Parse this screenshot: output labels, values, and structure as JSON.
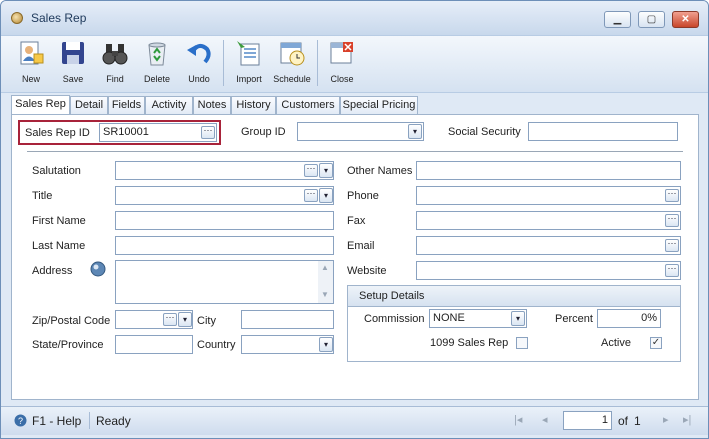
{
  "window": {
    "title": "Sales Rep",
    "minimize": "▁",
    "maximize": "▢",
    "close": "✕"
  },
  "toolbar": {
    "new": "New",
    "save": "Save",
    "find": "Find",
    "delete": "Delete",
    "undo": "Undo",
    "import": "Import",
    "schedule": "Schedule",
    "close": "Close"
  },
  "tabs": [
    "Sales Rep",
    "Detail",
    "Fields",
    "Activity",
    "Notes",
    "History",
    "Customers",
    "Special Pricing"
  ],
  "form": {
    "sales_rep_id_label": "Sales Rep ID",
    "sales_rep_id": "SR10001",
    "group_id_label": "Group ID",
    "group_id": "",
    "social_security_label": "Social Security",
    "social_security": "",
    "salutation_label": "Salutation",
    "salutation": "",
    "title_label": "Title",
    "title": "",
    "first_name_label": "First Name",
    "first_name": "",
    "last_name_label": "Last Name",
    "last_name": "",
    "address_label": "Address",
    "address": "",
    "zip_label": "Zip/Postal Code",
    "zip": "",
    "city_label": "City",
    "city": "",
    "state_label": "State/Province",
    "state": "",
    "country_label": "Country",
    "country": "",
    "other_names_label": "Other Names",
    "other_names": "",
    "phone_label": "Phone",
    "phone": "",
    "fax_label": "Fax",
    "fax": "",
    "email_label": "Email",
    "email": "",
    "website_label": "Website",
    "website": ""
  },
  "setup": {
    "header": "Setup Details",
    "commission_label": "Commission",
    "commission": "NONE",
    "percent_label": "Percent",
    "percent": "0%",
    "sales_rep_1099_label": "1099 Sales Rep",
    "sales_rep_1099": false,
    "active_label": "Active",
    "active": true
  },
  "status": {
    "help": "F1 - Help",
    "state": "Ready",
    "page": "1",
    "of_label": "of",
    "total_pages": "1"
  },
  "glyphs": {
    "dots": "···",
    "dropdown": "▾",
    "check": "✓",
    "first": "|◂",
    "prev": "◂",
    "next": "▸",
    "last": "▸|"
  }
}
